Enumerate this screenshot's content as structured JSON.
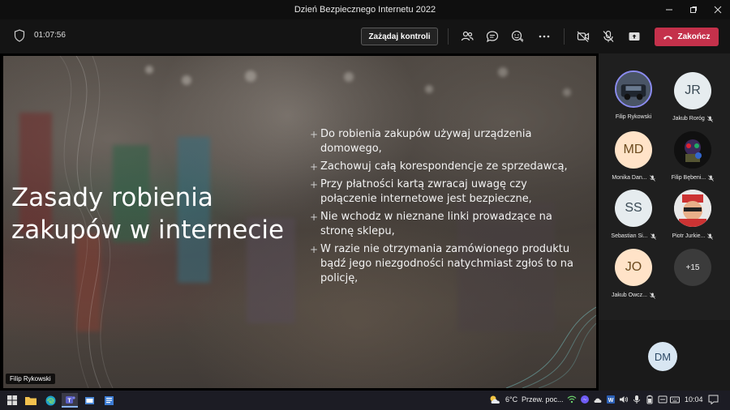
{
  "window": {
    "title": "Dzień Bezpiecznego Internetu 2022",
    "controls": [
      "minimize",
      "maximize",
      "close"
    ]
  },
  "meeting": {
    "timer": "01:07:56",
    "request_control_label": "Zażądaj kontroli",
    "end_label": "Zakończ",
    "toolbar_icons": [
      "participants-icon",
      "chat-icon",
      "reactions-icon",
      "more-icon",
      "camera-off-icon",
      "mic-off-icon",
      "share-icon"
    ]
  },
  "slide": {
    "title_line1": "Zasady robienia",
    "title_line2": "zakupów w internecie",
    "bullets": [
      "Do robienia zakupów używaj urządzenia domowego,",
      "Zachowuj całą korespondencje ze sprzedawcą,",
      "Przy płatności kartą zwracaj uwagę czy połączenie internetowe jest bezpieczne,",
      "Nie wchodz w nieznane linki prowadzące na stronę sklepu,",
      "W razie nie otrzymania zamówionego produktu bądź jego niezgodności natychmiast zgłoś to na policję,"
    ],
    "presenter": "Filip Rykowski"
  },
  "participants": [
    {
      "name": "Filip Rykowski",
      "initials": "",
      "type": "photo",
      "muted": false
    },
    {
      "name": "Jakub Roróg",
      "initials": "JR",
      "type": "gray",
      "muted": true
    },
    {
      "name": "Monika Dan...",
      "initials": "MD",
      "type": "init",
      "muted": true
    },
    {
      "name": "Filip Bębeni...",
      "initials": "",
      "type": "photo",
      "muted": true
    },
    {
      "name": "Sebastian Si...",
      "initials": "SS",
      "type": "gray",
      "muted": true
    },
    {
      "name": "Piotr Jurkie...",
      "initials": "",
      "type": "photo",
      "muted": true
    },
    {
      "name": "Jakub Owcz...",
      "initials": "JO",
      "type": "init",
      "muted": true
    }
  ],
  "more_participants": "+15",
  "self_initials": "DM",
  "taskbar": {
    "weather_temp": "6°C",
    "weather_text": "Przew. poc...",
    "clock": "10:04"
  }
}
